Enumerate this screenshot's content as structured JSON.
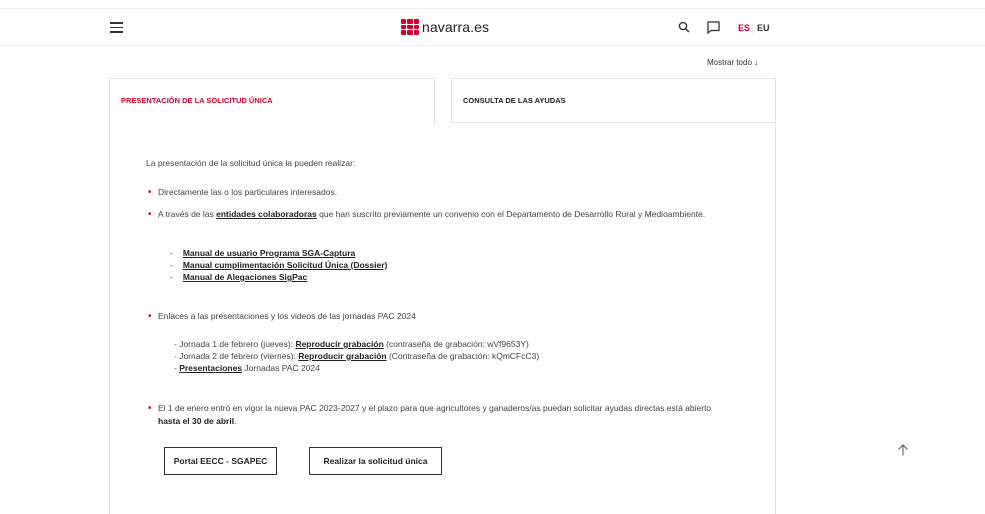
{
  "header": {
    "logo_text": "navarra.es",
    "lang_es": "ES",
    "lang_sep": "|",
    "lang_eu": "EU",
    "brand_color": "#d2002e"
  },
  "show_all_label": "Mostrar todo ↓",
  "tabs": [
    {
      "label": "PRESENTACIÓN DE LA SOLICITUD ÚNICA",
      "active": true
    },
    {
      "label": "CONSULTA DE LAS AYUDAS",
      "active": false
    }
  ],
  "content": {
    "intro": "La presentación de la solicitud única la pueden realizar:",
    "bullet1": "Directamente las o los particulares interesados.",
    "bullet2": {
      "prefix": "A través de las ",
      "link": "entidades colaboradoras",
      "suffix": " que han suscrito previamente un convenio con el Departamento de Desarrollo Rural y Medioambiente."
    },
    "manuals": [
      "Manual de usuario Programa SGA-Captura",
      "Manual cumplimentación Solicitud Única (Dossier)",
      "Manual de Alegaciones SigPac"
    ],
    "bullet3": "Enlaces a las presentaciones y los videos de las jornadas PAC 2024",
    "jornada1": {
      "prefix": "- Jornada 1 de febrero (jueves): ",
      "link": "Reproducir grabación",
      "suffix": " (contraseña de grabación: wVf9653Y)"
    },
    "jornada2": {
      "prefix": "- Jornada 2 de febrero (viernes): ",
      "link": "Reproducir grabación",
      "suffix": " (Contraseña de grabación: kQmCFcC3)"
    },
    "presentaciones": {
      "prefix": "- ",
      "link": "Presentaciones",
      "suffix": " Jornadas PAC 2024"
    },
    "bullet4": {
      "prefix": "El 1 de enero entró en vigor la nueva PAC 2023-2027 y el plazo para que agricultores y ganaderos/as puedan solicitar ayudas directas está abierto ",
      "strong": "hasta el 30 de abril",
      "suffix": "."
    }
  },
  "buttons": {
    "portal": "Portal EECC - SGAPEC",
    "solicitud": "Realizar la solicitud única"
  },
  "icons": {
    "menu": "hamburger-icon",
    "search": "search-icon",
    "chat": "chat-icon",
    "scroll_top": "arrow-up-icon"
  }
}
